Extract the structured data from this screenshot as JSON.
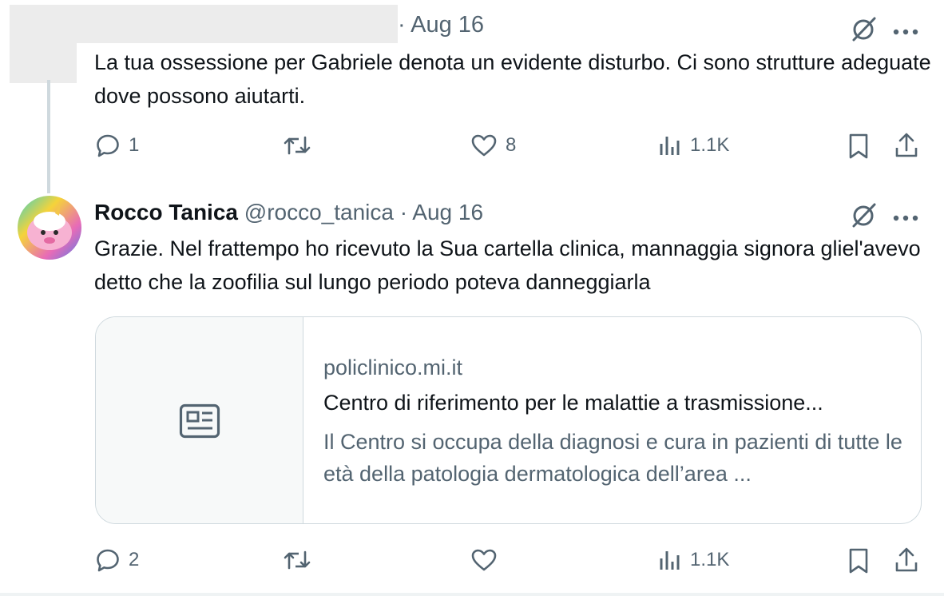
{
  "tweet1": {
    "date": "· Aug 16",
    "text": "La tua ossessione per Gabriele denota un evidente disturbo. Ci sono strutture adeguate dove possono aiutarti.",
    "replies": "1",
    "retweets": "",
    "likes": "8",
    "views": "1.1K"
  },
  "tweet2": {
    "name": "Rocco Tanica",
    "handle": "@rocco_tanica",
    "date": "· Aug 16",
    "text": "Grazie. Nel frattempo ho ricevuto la Sua cartella clinica, mannaggia signora gliel'avevo detto che la zoofilia sul lungo periodo poteva danneggiarla",
    "card": {
      "domain": "policlinico.mi.it",
      "title": "Centro di riferimento per le malattie a trasmissione...",
      "description": "Il Centro si occupa della diagnosi e cura in pazienti di tutte le età della patologia dermatologica dell’area ..."
    },
    "replies": "2",
    "retweets": "",
    "likes": "",
    "views": "1.1K"
  },
  "icons": {
    "reply": "speech-bubble-icon",
    "retweet": "retweet-arrows-icon",
    "like": "heart-icon",
    "views": "bar-chart-icon",
    "bookmark": "bookmark-icon",
    "share": "share-upload-icon",
    "grok": "grok-slash-icon",
    "more": "more-dots-icon",
    "article": "article-icon"
  },
  "colors": {
    "text": "#0f1419",
    "secondary": "#536471",
    "border": "#cfd9de",
    "background": "#ffffff"
  }
}
